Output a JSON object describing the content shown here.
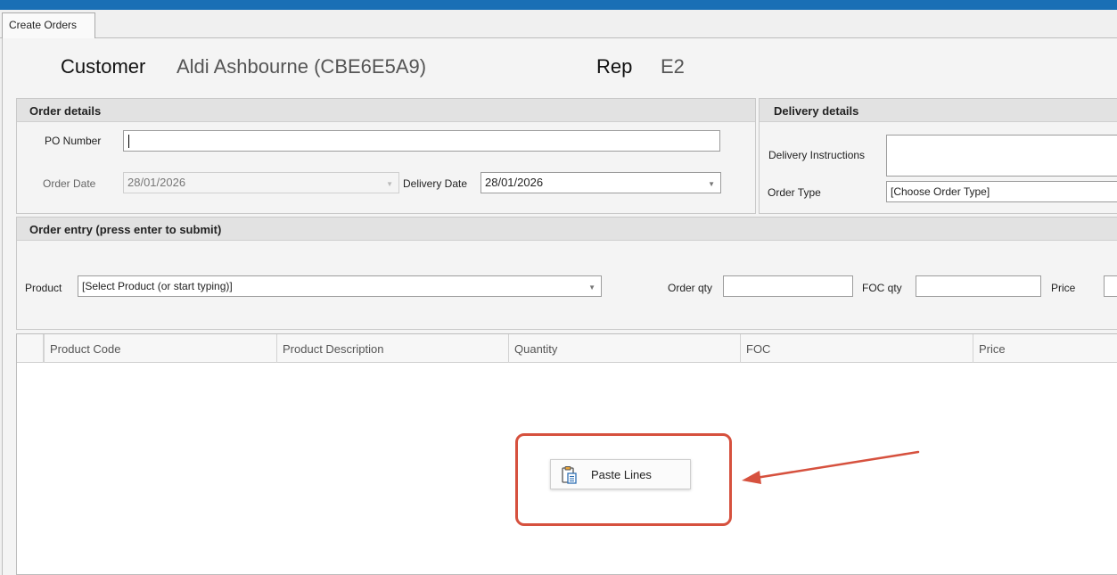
{
  "tabs": [
    {
      "label": "Create Orders"
    }
  ],
  "header": {
    "customer_label": "Customer",
    "customer_value": "Aldi Ashbourne (CBE6E5A9)",
    "rep_label": "Rep",
    "rep_value": "E2"
  },
  "order_details": {
    "title": "Order details",
    "po_number_label": "PO Number",
    "po_number_value": "",
    "order_date_label": "Order Date",
    "order_date_value": "28/01/2026",
    "delivery_date_label": "Delivery Date",
    "delivery_date_value": "28/01/2026"
  },
  "delivery_details": {
    "title": "Delivery details",
    "instructions_label": "Delivery Instructions",
    "instructions_value": "",
    "order_type_label": "Order Type",
    "order_type_value": "[Choose Order Type]"
  },
  "order_entry": {
    "title": "Order entry (press enter to submit)",
    "product_label": "Product",
    "product_value": "[Select Product (or start typing)]",
    "order_qty_label": "Order qty",
    "foc_qty_label": "FOC qty",
    "price_label": "Price"
  },
  "grid": {
    "columns": [
      "Product Code",
      "Product Description",
      "Quantity",
      "FOC",
      "Price"
    ]
  },
  "context_menu": {
    "items": [
      {
        "label": "Paste Lines",
        "icon": "paste-icon"
      }
    ]
  },
  "annotation": {
    "highlight_color": "#d6513e"
  },
  "colors": {
    "title_bar": "#1a6fb5"
  }
}
